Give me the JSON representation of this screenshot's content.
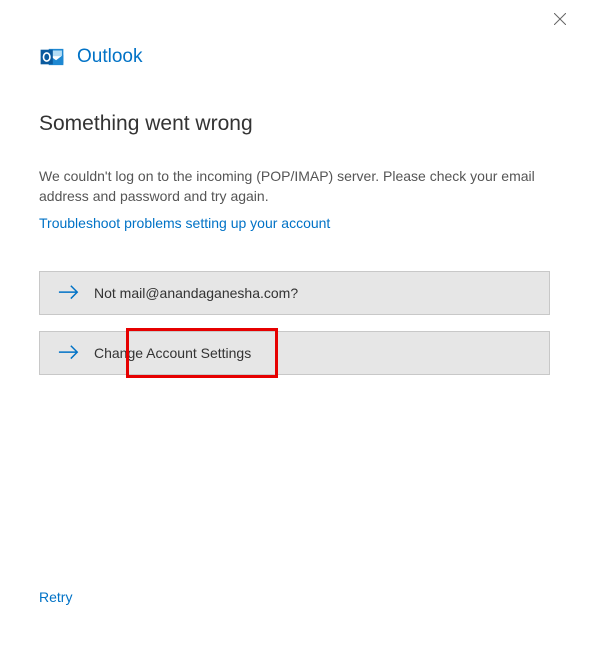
{
  "app": {
    "title": "Outlook"
  },
  "heading": "Something went wrong",
  "error_message": "We couldn't log on to the incoming (POP/IMAP) server. Please check your email address and password and try again.",
  "troubleshoot_link": "Troubleshoot problems setting up your account",
  "buttons": {
    "not_email": "Not mail@anandaganesha.com?",
    "change_settings": "Change Account Settings"
  },
  "retry_label": "Retry",
  "colors": {
    "accent": "#0072c6",
    "highlight": "#e60000"
  }
}
